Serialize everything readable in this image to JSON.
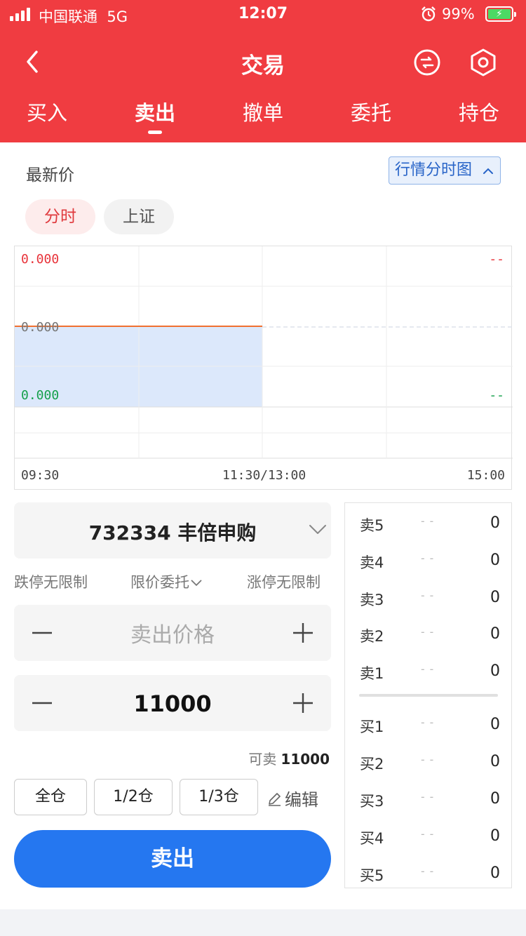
{
  "status_bar": {
    "carrier": "中国联通",
    "network": "5G",
    "time": "12:07",
    "battery_pct": "99%"
  },
  "navbar": {
    "title": "交易"
  },
  "tabs": [
    {
      "label": "买入"
    },
    {
      "label": "卖出",
      "active": true
    },
    {
      "label": "撤单"
    },
    {
      "label": "委托"
    },
    {
      "label": "持仓"
    }
  ],
  "latest": {
    "label": "最新价",
    "chart_toggle": "行情分时图"
  },
  "chart_pills": {
    "minute": "分时",
    "index": "上证"
  },
  "chart": {
    "high_label": "0.000",
    "mid_label": "0.000",
    "low_label": "0.000",
    "high_right": "--",
    "low_right": "--",
    "x_labels": [
      "09:30",
      "11:30/13:00",
      "15:00"
    ],
    "colors": {
      "up": "#e8333a",
      "down": "#15a04b",
      "price_line": "#f07030",
      "area": "#dce8fb"
    }
  },
  "form": {
    "stock": "732334  丰倍申购",
    "limit_down": "跌停无限制",
    "order_type": "限价委托",
    "limit_up": "涨停无限制",
    "price_placeholder": "卖出价格",
    "quantity": "11000",
    "available_label": "可卖",
    "available_value": "11000",
    "position_buttons": [
      "全仓",
      "1/2仓",
      "1/3仓"
    ],
    "edit_label": "编辑",
    "submit_label": "卖出"
  },
  "order_book": {
    "asks": [
      {
        "label": "卖5",
        "price": "--",
        "volume": "0"
      },
      {
        "label": "卖4",
        "price": "--",
        "volume": "0"
      },
      {
        "label": "卖3",
        "price": "--",
        "volume": "0"
      },
      {
        "label": "卖2",
        "price": "--",
        "volume": "0"
      },
      {
        "label": "卖1",
        "price": "--",
        "volume": "0"
      }
    ],
    "bids": [
      {
        "label": "买1",
        "price": "--",
        "volume": "0"
      },
      {
        "label": "买2",
        "price": "--",
        "volume": "0"
      },
      {
        "label": "买3",
        "price": "--",
        "volume": "0"
      },
      {
        "label": "买4",
        "price": "--",
        "volume": "0"
      },
      {
        "label": "买5",
        "price": "--",
        "volume": "0"
      }
    ]
  },
  "theme": {
    "header_red": "#f03c41",
    "primary_blue": "#2577f0"
  },
  "icons": {
    "back": "chevron-left-icon",
    "list": "list-circle-icon",
    "settings": "hexagon-gear-icon"
  }
}
